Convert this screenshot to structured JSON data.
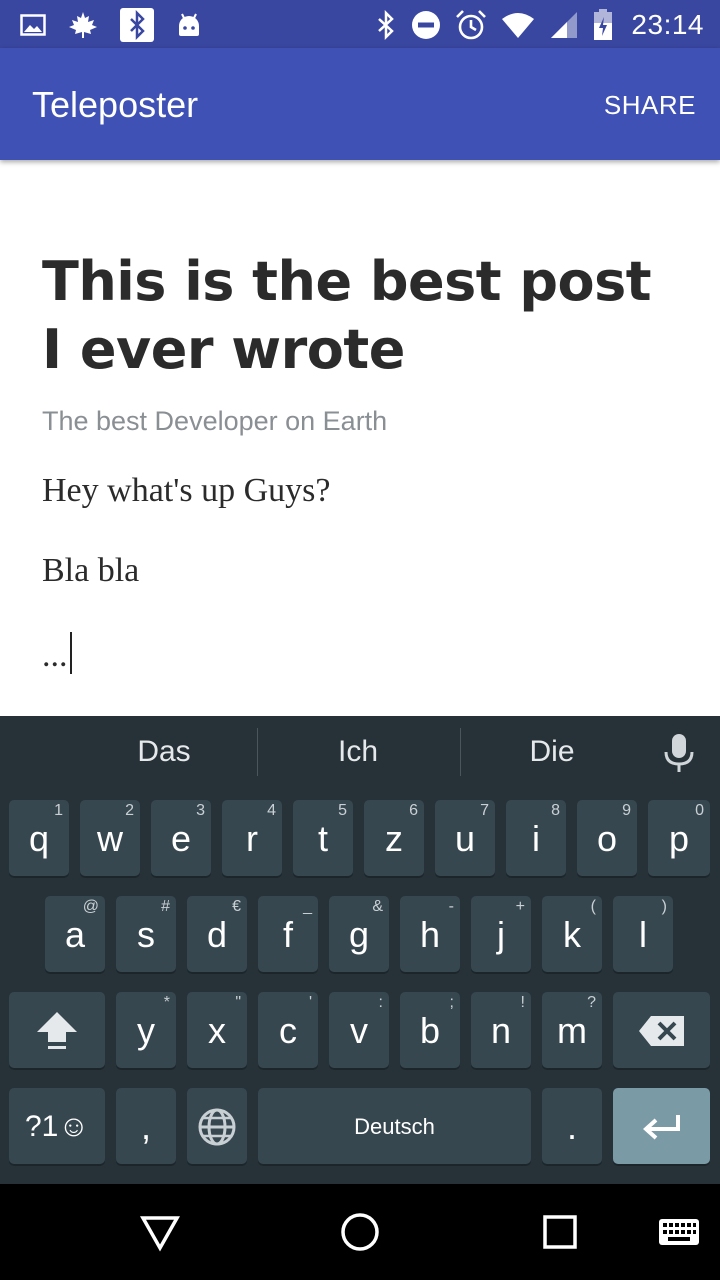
{
  "status_bar": {
    "time": "23:14",
    "icons_left": [
      "gallery-icon",
      "maple-leaf-icon",
      "bluetooth-notification-icon",
      "android-icon"
    ],
    "icons_right": [
      "bluetooth-icon",
      "do-not-disturb-icon",
      "alarm-icon",
      "wifi-icon",
      "cell-signal-icon",
      "battery-icon"
    ]
  },
  "app_bar": {
    "title": "Teleposter",
    "action": "SHARE"
  },
  "post": {
    "title": "This is the best post I ever wrote",
    "author": "The best Developer on Earth",
    "lines": [
      "Hey what's up Guys?",
      "Bla bla",
      "..."
    ]
  },
  "keyboard": {
    "suggestions": [
      "Das",
      "Ich",
      "Die"
    ],
    "row1": [
      {
        "main": "q",
        "hint": "1"
      },
      {
        "main": "w",
        "hint": "2"
      },
      {
        "main": "e",
        "hint": "3"
      },
      {
        "main": "r",
        "hint": "4"
      },
      {
        "main": "t",
        "hint": "5"
      },
      {
        "main": "z",
        "hint": "6"
      },
      {
        "main": "u",
        "hint": "7"
      },
      {
        "main": "i",
        "hint": "8"
      },
      {
        "main": "o",
        "hint": "9"
      },
      {
        "main": "p",
        "hint": "0"
      }
    ],
    "row2": [
      {
        "main": "a",
        "hint": "@"
      },
      {
        "main": "s",
        "hint": "#"
      },
      {
        "main": "d",
        "hint": "€"
      },
      {
        "main": "f",
        "hint": "_"
      },
      {
        "main": "g",
        "hint": "&"
      },
      {
        "main": "h",
        "hint": "-"
      },
      {
        "main": "j",
        "hint": "+"
      },
      {
        "main": "k",
        "hint": "("
      },
      {
        "main": "l",
        "hint": ")"
      }
    ],
    "row3": [
      {
        "main": "y",
        "hint": "*"
      },
      {
        "main": "x",
        "hint": "\""
      },
      {
        "main": "c",
        "hint": "'"
      },
      {
        "main": "v",
        "hint": ":"
      },
      {
        "main": "b",
        "hint": ";"
      },
      {
        "main": "n",
        "hint": "!"
      },
      {
        "main": "m",
        "hint": "?"
      }
    ],
    "symbols_key": "?1☺",
    "comma_key": ",",
    "space_label": "Deutsch",
    "period_key": ".",
    "colors": {
      "background": "#263238",
      "key": "#37474f",
      "enter": "#7a9aa6"
    }
  },
  "nav_bar": {
    "icons": [
      "back-icon",
      "home-icon",
      "recents-icon",
      "keyboard-switch-icon"
    ]
  },
  "colors": {
    "status_bar": "#3a47a1",
    "app_bar": "#3f51b5"
  }
}
